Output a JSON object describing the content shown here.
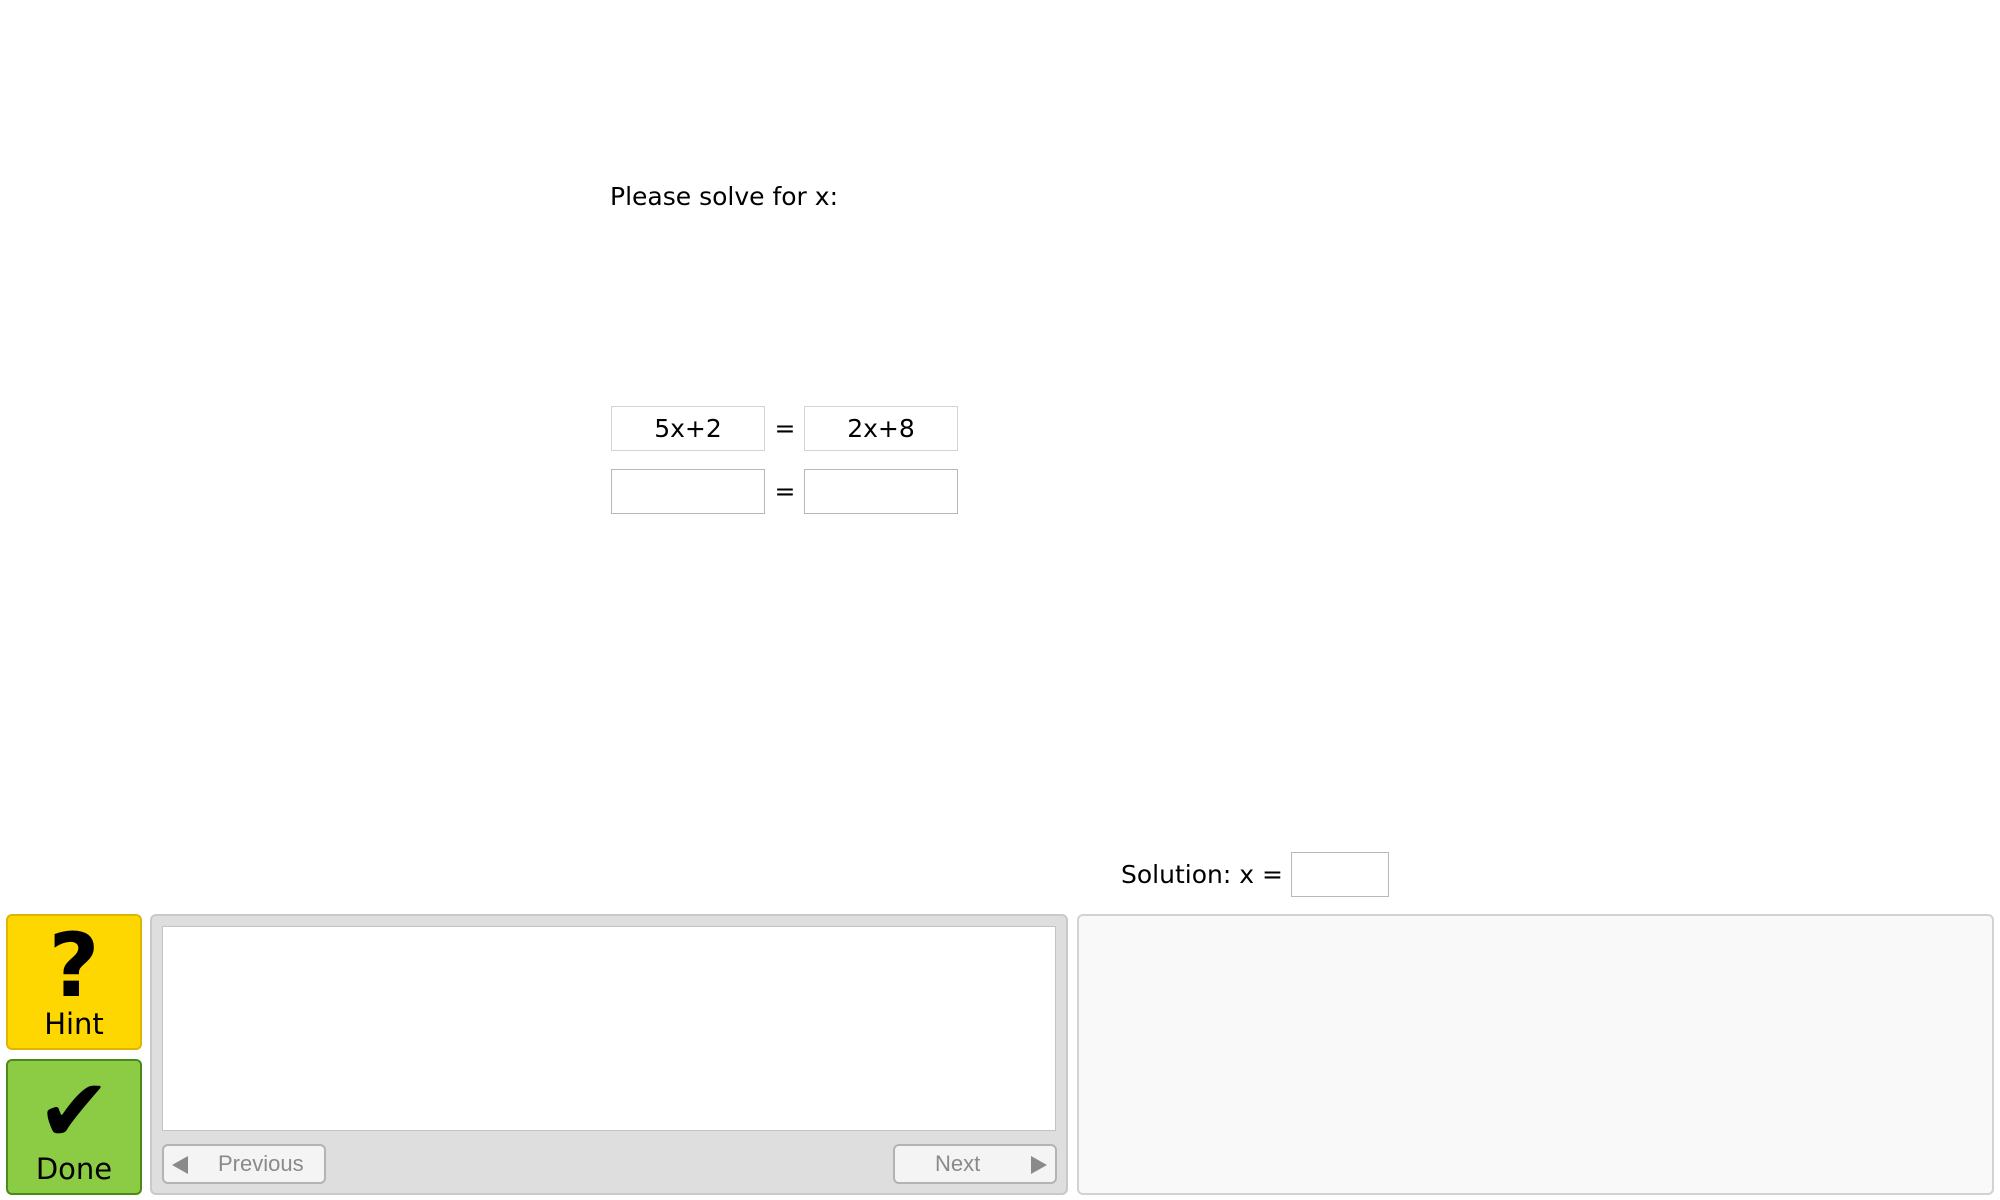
{
  "problem": {
    "prompt": "Please solve for x:",
    "rows": [
      {
        "left": "5x+2",
        "equals": "=",
        "right": "2x+8"
      },
      {
        "left": "",
        "equals": "=",
        "right": ""
      }
    ]
  },
  "solution": {
    "label": "Solution: x =",
    "value": ""
  },
  "buttons": {
    "hint_label": "Hint",
    "hint_glyph": "?",
    "done_label": "Done",
    "done_glyph": "✔"
  },
  "hint_panel": {
    "text": "",
    "previous_label": "Previous",
    "next_label": "Next"
  },
  "colors": {
    "hint_button": "#ffd700",
    "done_button": "#8ccb44",
    "panel_background": "#dedede"
  },
  "icons": {
    "hint": "question-mark-icon",
    "done": "checkmark-icon",
    "previous": "triangle-left-icon",
    "next": "triangle-right-icon"
  }
}
